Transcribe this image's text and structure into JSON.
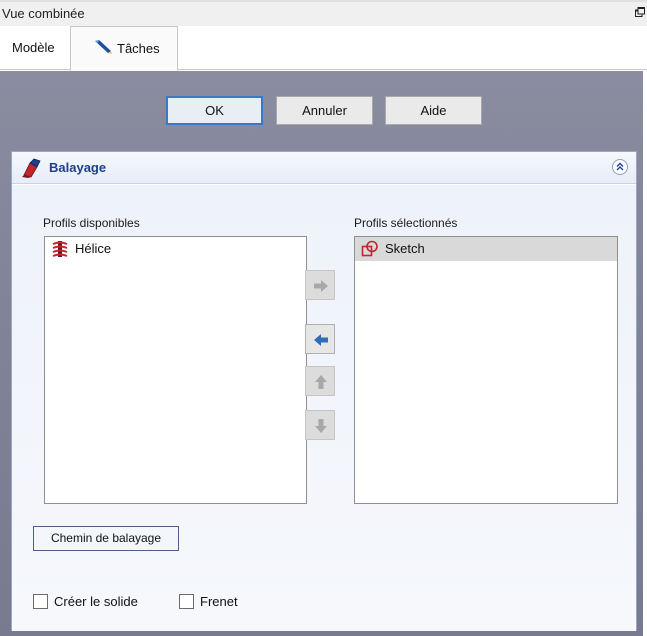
{
  "window": {
    "title": "Vue combinée",
    "float_icon": "undock-icon"
  },
  "tabs": [
    {
      "label": "Modèle",
      "icon": ""
    },
    {
      "label": "Tâches",
      "icon": "pencil-icon"
    }
  ],
  "dialog_buttons": {
    "ok": "OK",
    "cancel": "Annuler",
    "help": "Aide"
  },
  "panel": {
    "title": "Balayage",
    "icon": "sweep-icon",
    "collapse_icon": "collapse-up-icon",
    "available_label": "Profils disponibles",
    "selected_label": "Profils sélectionnés",
    "available_items": [
      {
        "label": "Hélice",
        "icon": "helix-icon"
      }
    ],
    "selected_items": [
      {
        "label": "Sketch",
        "icon": "sketch-icon"
      }
    ],
    "arrow_buttons": [
      {
        "icon": "arrow-right-icon",
        "enabled": false
      },
      {
        "icon": "arrow-left-icon",
        "enabled": true
      },
      {
        "icon": "arrow-up-icon",
        "enabled": false
      },
      {
        "icon": "arrow-down-icon",
        "enabled": false
      }
    ],
    "sweep_path_button": "Chemin de balayage",
    "checkboxes": {
      "create_solid": {
        "label": "Créer le solide",
        "checked": false
      },
      "frenet": {
        "label": "Frenet",
        "checked": false
      }
    }
  },
  "colors": {
    "task_background": "#83869a",
    "panel_title": "#1d3f8c",
    "ok_border": "#3a78c9",
    "enabled_arrow": "#2f6db8",
    "disabled_arrow": "#a8a8a8"
  }
}
